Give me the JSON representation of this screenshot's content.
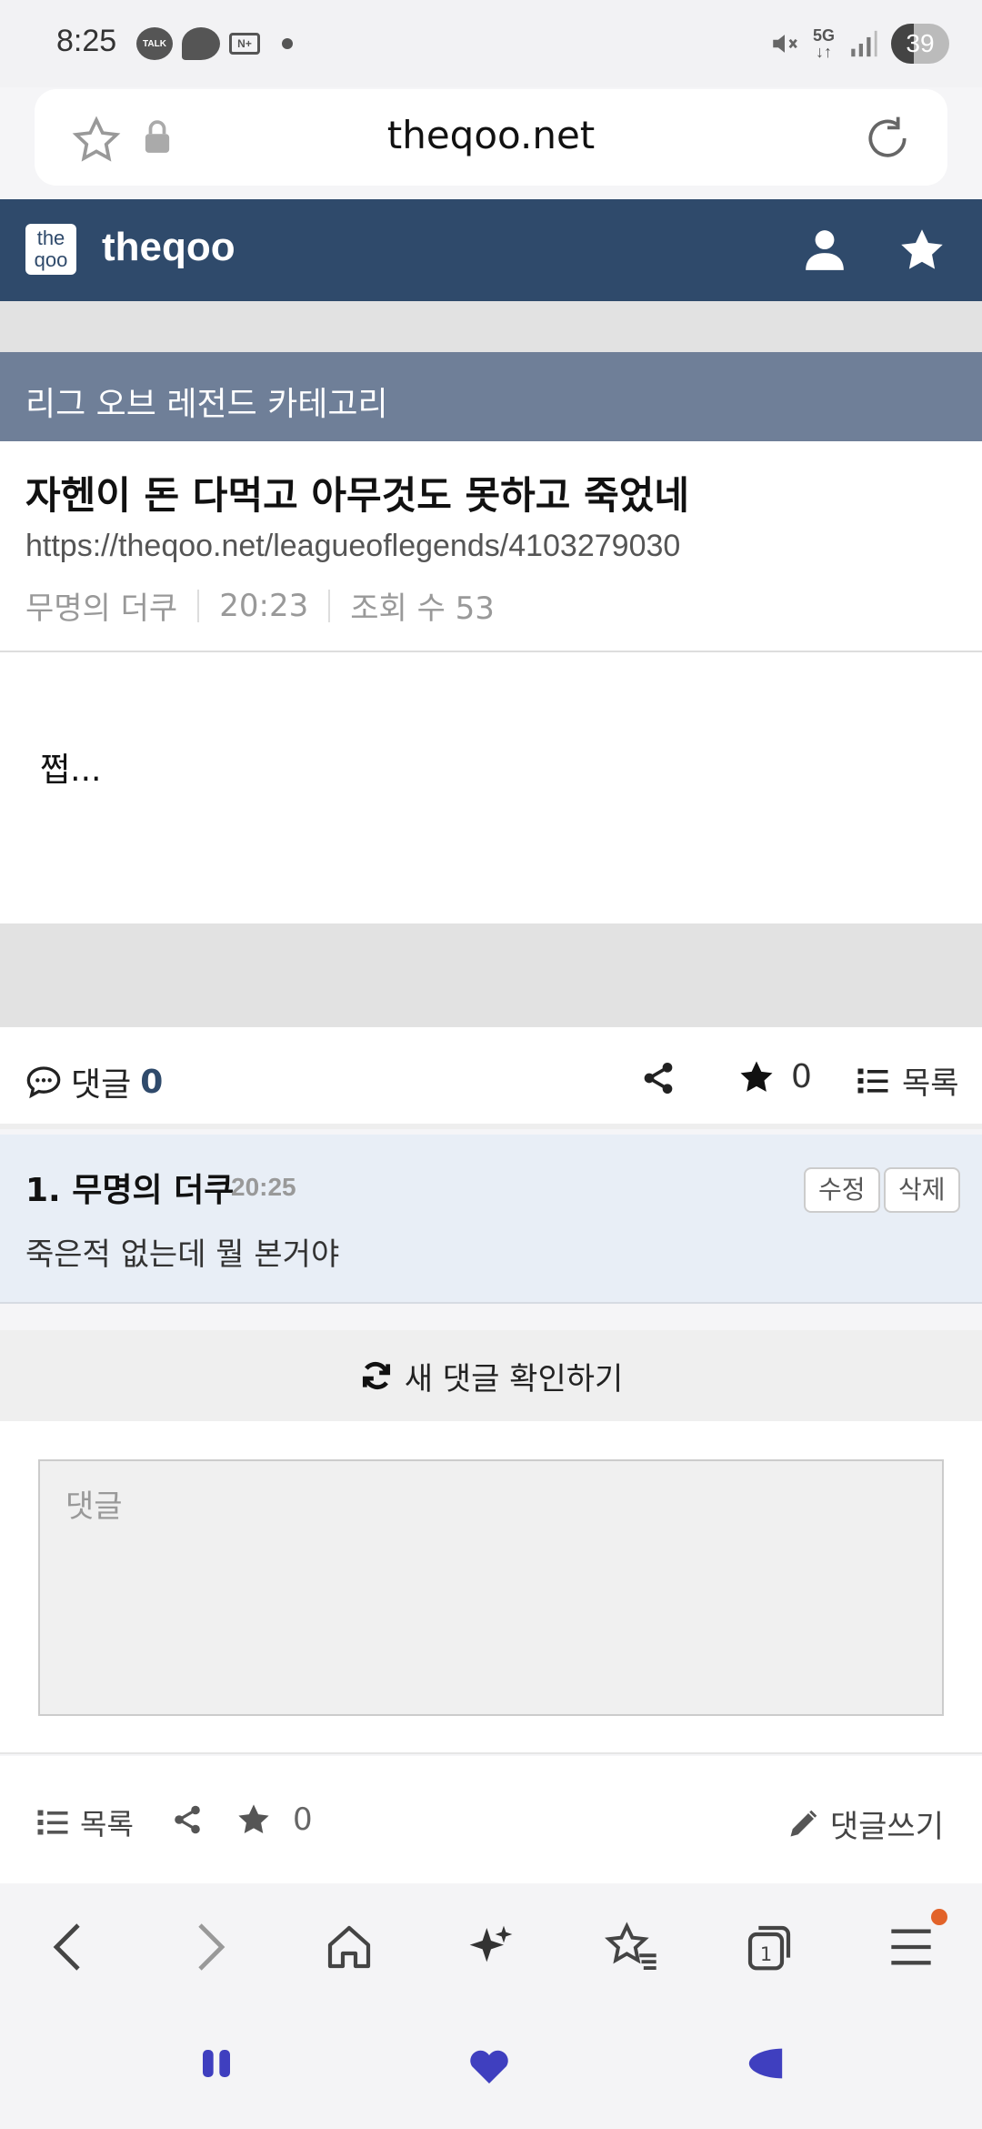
{
  "status_bar": {
    "time": "8:25",
    "talk_label": "TALK",
    "nplus_label": "N+",
    "network": "5G",
    "battery": "39"
  },
  "address_bar": {
    "url": "theqoo.net"
  },
  "site_header": {
    "logo_text_top": "the",
    "logo_text_bottom": "qoo",
    "site_name": "theqoo"
  },
  "category": {
    "title": "리그 오브 레전드 카테고리"
  },
  "post": {
    "title": "자헨이 돈 다먹고 아무것도 못하고 죽었네",
    "url": "https://theqoo.net/leagueoflegends/4103279030",
    "author": "무명의 더쿠",
    "time": "20:23",
    "views": "조회 수 53",
    "body": "쩝..."
  },
  "action_bar": {
    "comments_label": "댓글",
    "comments_count": "0",
    "star_count": "0",
    "list_label": "목록"
  },
  "comments": [
    {
      "author": "1. 무명의 더쿠",
      "time": "20:25",
      "edit_label": "수정",
      "delete_label": "삭제",
      "text": "죽은적 없는데 뭘 본거야"
    }
  ],
  "refresh_label": "새 댓글 확인하기",
  "comment_input": {
    "placeholder": "댓글"
  },
  "bottom_actions": {
    "list_label": "목록",
    "star_count": "0",
    "write_label": "댓글쓰기"
  },
  "browser_nav": {
    "tabs_count": "1"
  },
  "colors": {
    "header": "#2f4a6b",
    "category": "#6f7f98",
    "comment_bg": "#e8eef6",
    "gesture_accent": "#3f3fbf",
    "notification_dot": "#e2632a"
  }
}
